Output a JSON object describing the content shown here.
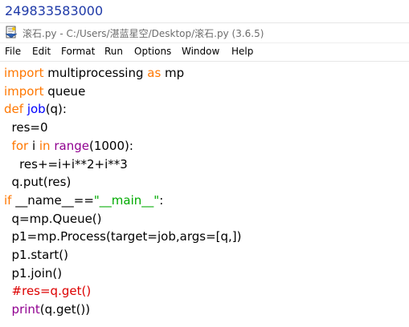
{
  "output": {
    "value": "249833583000"
  },
  "window": {
    "title": "滚石.py - C:/Users/湛蓝星空/Desktop/滚石.py (3.6.5)"
  },
  "menu": [
    "File",
    "Edit",
    "Format",
    "Run",
    "Options",
    "Window",
    "Help"
  ],
  "colors": {
    "keyword": "#ff7700",
    "builtin": "#900090",
    "definition": "#0000ff",
    "string": "#00aa00",
    "comment": "#dd0000",
    "output": "#1f3aa8"
  },
  "code": [
    [
      {
        "t": "import",
        "c": "kw"
      },
      {
        "t": " multiprocessing ",
        "c": "tx"
      },
      {
        "t": "as",
        "c": "kw"
      },
      {
        "t": " mp",
        "c": "tx"
      }
    ],
    [
      {
        "t": "import",
        "c": "kw"
      },
      {
        "t": " queue",
        "c": "tx"
      }
    ],
    [
      {
        "t": "def",
        "c": "kw"
      },
      {
        "t": " ",
        "c": "tx"
      },
      {
        "t": "job",
        "c": "def"
      },
      {
        "t": "(q):",
        "c": "tx"
      }
    ],
    [
      {
        "t": "  res=0",
        "c": "tx"
      }
    ],
    [
      {
        "t": "  ",
        "c": "tx"
      },
      {
        "t": "for",
        "c": "kw"
      },
      {
        "t": " i ",
        "c": "tx"
      },
      {
        "t": "in",
        "c": "kw"
      },
      {
        "t": " ",
        "c": "tx"
      },
      {
        "t": "range",
        "c": "bi"
      },
      {
        "t": "(1000):",
        "c": "tx"
      }
    ],
    [
      {
        "t": "    res+=i+i**2+i**3",
        "c": "tx"
      }
    ],
    [
      {
        "t": "  q.put(res)",
        "c": "tx"
      }
    ],
    [
      {
        "t": "if",
        "c": "kw"
      },
      {
        "t": " __name__==",
        "c": "tx"
      },
      {
        "t": "\"__main__\"",
        "c": "str"
      },
      {
        "t": ":",
        "c": "tx"
      }
    ],
    [
      {
        "t": "  q=mp.Queue()",
        "c": "tx"
      }
    ],
    [
      {
        "t": "  p1=mp.Process(target=job,args=[q,])",
        "c": "tx"
      }
    ],
    [
      {
        "t": "  p1.start()",
        "c": "tx"
      }
    ],
    [
      {
        "t": "  p1.join()",
        "c": "tx"
      }
    ],
    [
      {
        "t": "  #res=q.get()",
        "c": "cm"
      }
    ],
    [
      {
        "t": "  ",
        "c": "tx"
      },
      {
        "t": "print",
        "c": "bi"
      },
      {
        "t": "(q.get())",
        "c": "tx"
      }
    ]
  ]
}
